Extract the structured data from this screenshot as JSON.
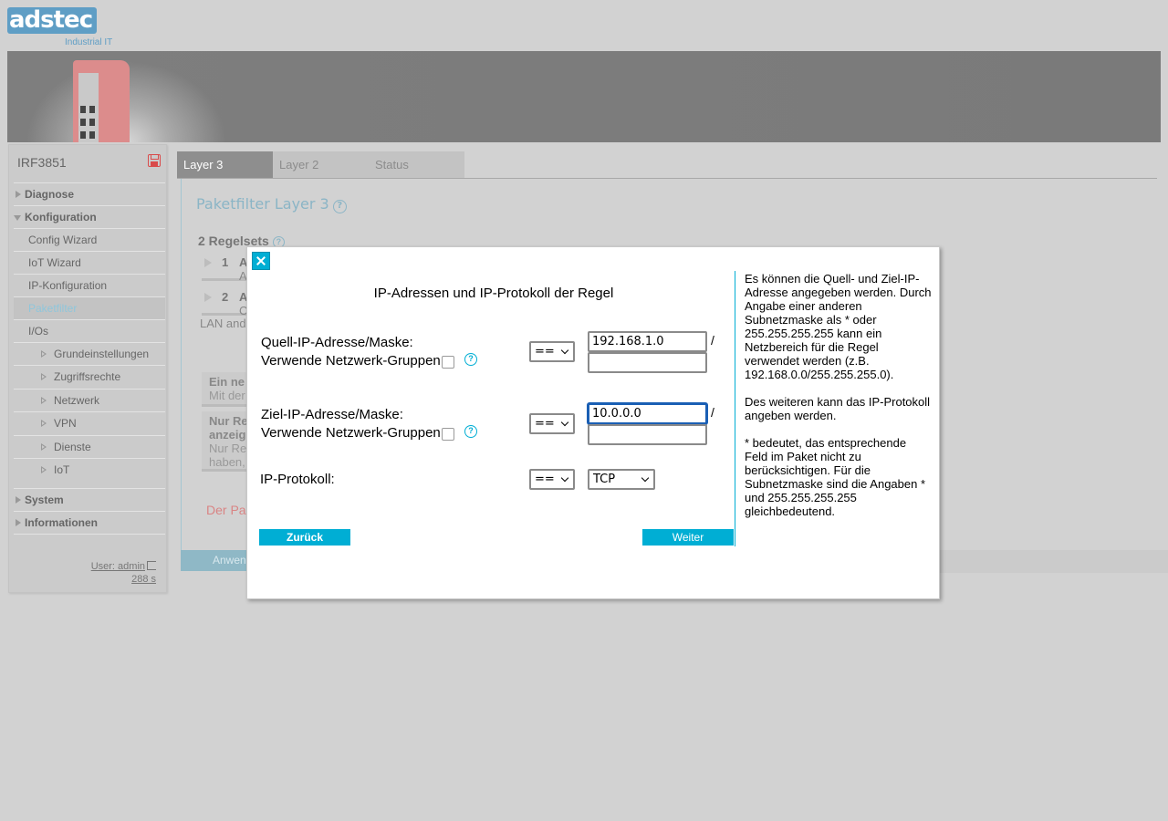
{
  "brand": {
    "logo_text": "adstec",
    "tagline": "Industrial IT"
  },
  "sidebar": {
    "device_name": "IRF3851",
    "items": [
      {
        "label": "Diagnose"
      },
      {
        "label": "Konfiguration"
      },
      {
        "label": "Config Wizard"
      },
      {
        "label": "IoT Wizard"
      },
      {
        "label": "IP-Konfiguration"
      },
      {
        "label": "Paketfilter"
      },
      {
        "label": "I/Os"
      },
      {
        "label": "Grundeinstellungen"
      },
      {
        "label": "Zugriffsrechte"
      },
      {
        "label": "Netzwerk"
      },
      {
        "label": "VPN"
      },
      {
        "label": "Dienste"
      },
      {
        "label": "IoT"
      },
      {
        "label": "System"
      },
      {
        "label": "Informationen"
      }
    ],
    "user": "User: admin",
    "session_timer": "288 s"
  },
  "tabs": [
    {
      "label": "Layer 3"
    },
    {
      "label": "Layer 2"
    },
    {
      "label": "Status"
    }
  ],
  "content": {
    "title": "Paketfilter Layer 3",
    "regelsets_heading": "2 Regelsets",
    "rule1_num": "1",
    "rule1_frag": "A",
    "rule1_frag2": "A",
    "rule2_num": "2",
    "rule2_frag": "A",
    "rule2_frag2": "C",
    "rule2_frag3": "LAN and",
    "card1_title": "Ein ne",
    "card1_sub": "Mit der",
    "card2_title1": "Nur Re",
    "card2_title2": "anzeig",
    "card2_sub1": "Nur Re",
    "card2_sub2": "haben,",
    "warning": "Der Pa",
    "apply_label": "Anwen"
  },
  "dialog": {
    "title": "IP-Adressen und IP-Protokoll der Regel",
    "source_label": "Quell-IP-Adresse/Maske:",
    "source_groups_label": "Verwende Netzwerk-Gruppen",
    "source_operator": "==",
    "source_ip": "192.168.1.0",
    "source_mask": "",
    "dest_label": "Ziel-IP-Adresse/Maske:",
    "dest_groups_label": "Verwende Netzwerk-Gruppen",
    "dest_operator": "==",
    "dest_ip": "10.0.0.0",
    "dest_mask": "",
    "protocol_label": "IP-Protokoll:",
    "protocol_operator": "==",
    "protocol_value": "TCP",
    "slash": "/",
    "back_button": "Zurück",
    "next_button": "Weiter",
    "info_paragraphs": [
      "Es können die Quell- und Ziel-IP-Adresse angegeben werden. Durch Angabe einer anderen Subnetzmaske als * oder 255.255.255.255 kann ein Netzbereich für die Regel verwendet werden (z.B. 192.168.0.0/255.255.255.0).",
      "Des weiteren kann das IP-Protokoll angeben werden.",
      "* bedeutet, das entsprechende Feld im Paket nicht zu berücksichtigen. Für die Subnetzmaske sind die Angaben * und 255.255.255.255 gleichbedeutend."
    ]
  }
}
